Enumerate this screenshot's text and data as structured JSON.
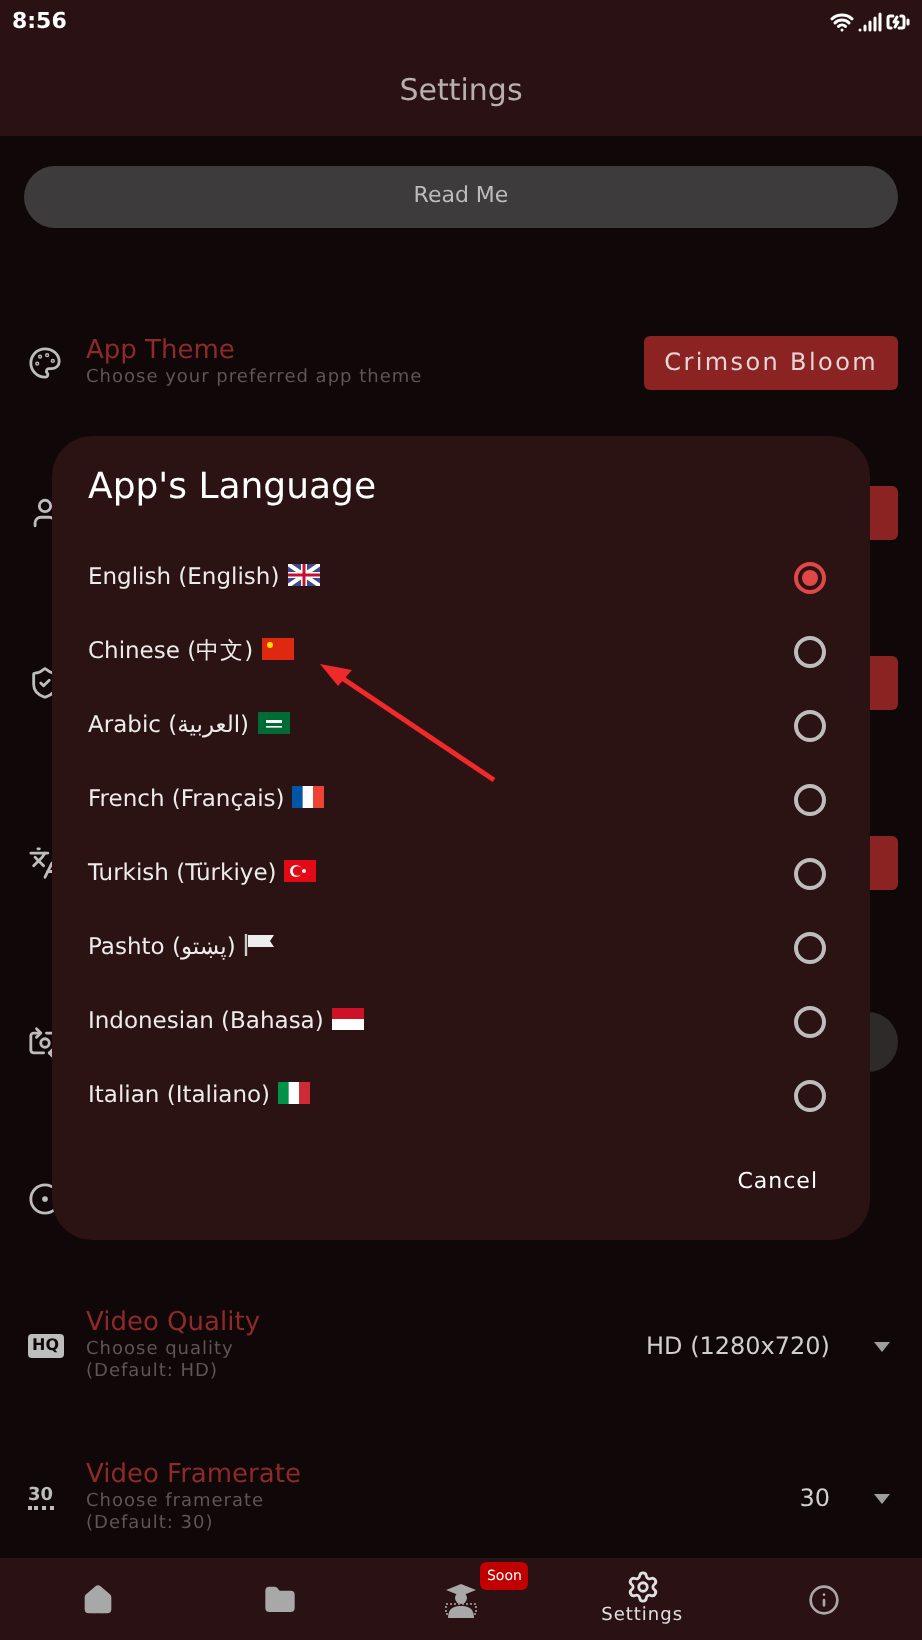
{
  "status_bar": {
    "time": "8:56"
  },
  "app_bar": {
    "title": "Settings"
  },
  "read_me_button": "Read Me",
  "settings": [
    {
      "kind": "button",
      "title": "App Theme",
      "description": [
        "Choose your preferred app theme"
      ],
      "value": "Crimson Bloom"
    },
    {
      "kind": "button_hidden"
    },
    {
      "kind": "button_hidden"
    },
    {
      "kind": "button_hidden"
    },
    {
      "kind": "toggle_hidden",
      "on": false
    },
    {
      "kind": "plain_hidden"
    },
    {
      "kind": "dropdown",
      "icon_text": "HQ",
      "title": "Video Quality",
      "description": [
        "Choose quality",
        "(Default: HD)"
      ],
      "value": "HD (1280x720)"
    },
    {
      "kind": "dropdown",
      "icon_text": "30",
      "title": "Video Framerate",
      "description": [
        "Choose framerate",
        "(Default: 30)"
      ],
      "value": "30"
    }
  ],
  "dialog": {
    "title": "App's Language",
    "options": [
      {
        "label": "English (English)",
        "selected": true
      },
      {
        "label": "Chinese (中文)",
        "selected": false
      },
      {
        "label": "Arabic (العربية)",
        "selected": false
      },
      {
        "label": "French (Français)",
        "selected": false
      },
      {
        "label": "Turkish (Türkiye)",
        "selected": false
      },
      {
        "label": "Pashto (پښتو)",
        "selected": false
      },
      {
        "label": "Indonesian (Bahasa)",
        "selected": false
      },
      {
        "label": "Italian (Italiano)",
        "selected": false
      }
    ],
    "cancel": "Cancel"
  },
  "bottom_nav": [
    {
      "kind": "home",
      "selected": false
    },
    {
      "kind": "folder",
      "selected": false
    },
    {
      "kind": "teacher",
      "badge": "Soon",
      "selected": false
    },
    {
      "kind": "settings",
      "label": "Settings",
      "selected": true
    },
    {
      "kind": "info",
      "selected": false
    }
  ]
}
